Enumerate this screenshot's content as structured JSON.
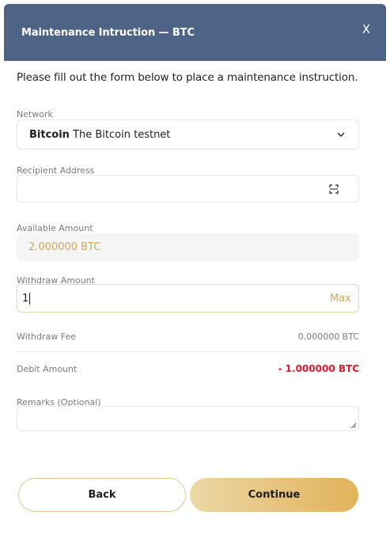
{
  "dialog": {
    "title": "Maintenance Intruction — BTC",
    "close_glyph": "X",
    "intro": "Please fill out the form below to place a maintenance instruction."
  },
  "network": {
    "label": "Network",
    "selected_name": "Bitcoin",
    "selected_desc": "The Bitcoin testnet"
  },
  "recipient": {
    "label": "Recipient Address",
    "value": ""
  },
  "available": {
    "label": "Available Amount",
    "value": "2.000000 BTC"
  },
  "withdraw": {
    "label": "Withdraw Amount",
    "value": "1",
    "max_label": "Max"
  },
  "fee": {
    "label": "Withdraw Fee",
    "value": "0.000000 BTC"
  },
  "debit": {
    "label": "Debit Amount",
    "value": "- 1.000000 BTC"
  },
  "remarks": {
    "label": "Remarks (Optional)",
    "value": ""
  },
  "actions": {
    "back_label": "Back",
    "continue_label": "Continue"
  },
  "colors": {
    "header_bg": "#4e6486",
    "accent_gold": "#c9a85c",
    "debit_red": "#e0182d"
  },
  "icons": {
    "close": "close-icon",
    "dropdown": "chevron-down-icon",
    "scan": "qr-scan-icon",
    "resize": "resize-grip-icon"
  }
}
